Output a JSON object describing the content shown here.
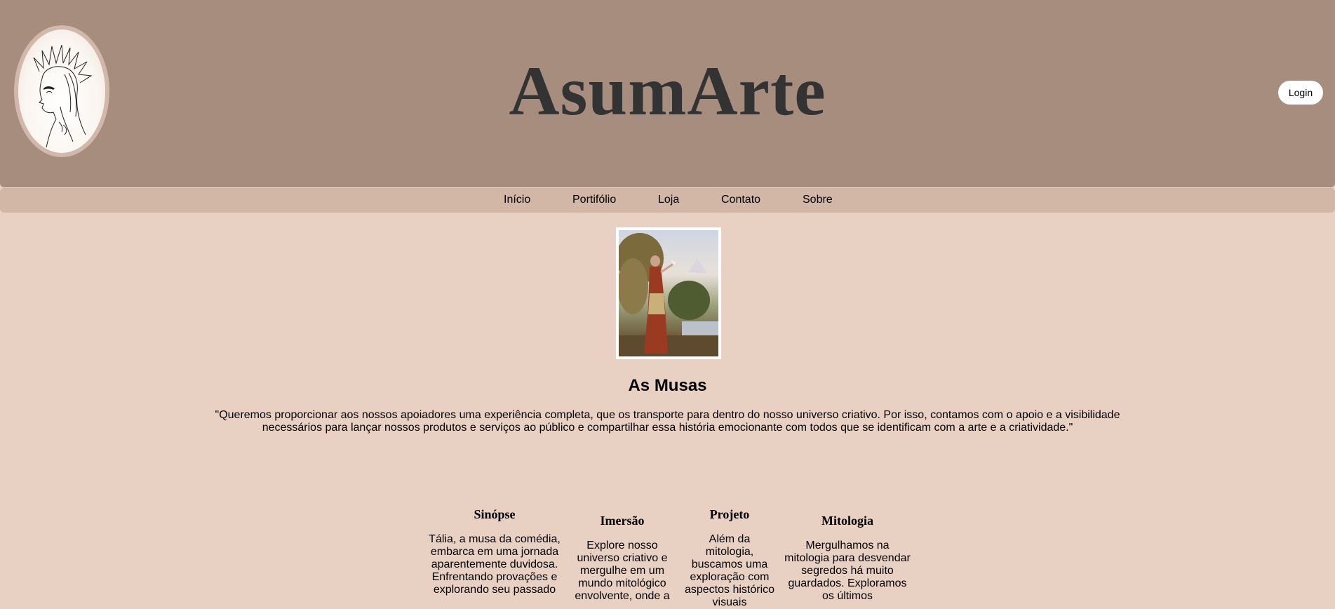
{
  "header": {
    "brand": "AsumArte",
    "login_label": "Login"
  },
  "nav": {
    "items": [
      "Início",
      "Portifólio",
      "Loja",
      "Contato",
      "Sobre"
    ]
  },
  "main": {
    "title": "As Musas",
    "quote": "\"Queremos proporcionar aos nossos apoiadores uma experiência completa, que os transporte para dentro do nosso universo criativo. Por isso, contamos com o apoio e a visibilidade necessários para lançar nossos produtos e serviços ao público e compartilhar essa história emocionante com todos que se identificam com a arte e a criatividade.\""
  },
  "sections": [
    {
      "title": "Sinópse",
      "text": "Tália, a musa da comédia, embarca em uma jornada aparentemente duvidosa. Enfrentando provações e explorando seu passado"
    },
    {
      "title": "Imersão",
      "text": "Explore nosso universo criativo e mergulhe em um mundo mitológico envolvente, onde a"
    },
    {
      "title": "Projeto",
      "text": "Além da mitologia, buscamos uma exploração com aspectos histórico visuais"
    },
    {
      "title": "Mitologia",
      "text": "Mergulhamos na mitologia para desvendar segredos há muito guardados. Exploramos os últimos"
    }
  ],
  "colors": {
    "header_bg": "#a68d7e",
    "nav_bg": "#d2b6a6",
    "page_bg": "#e8d0c3",
    "brand_text": "#333333"
  }
}
